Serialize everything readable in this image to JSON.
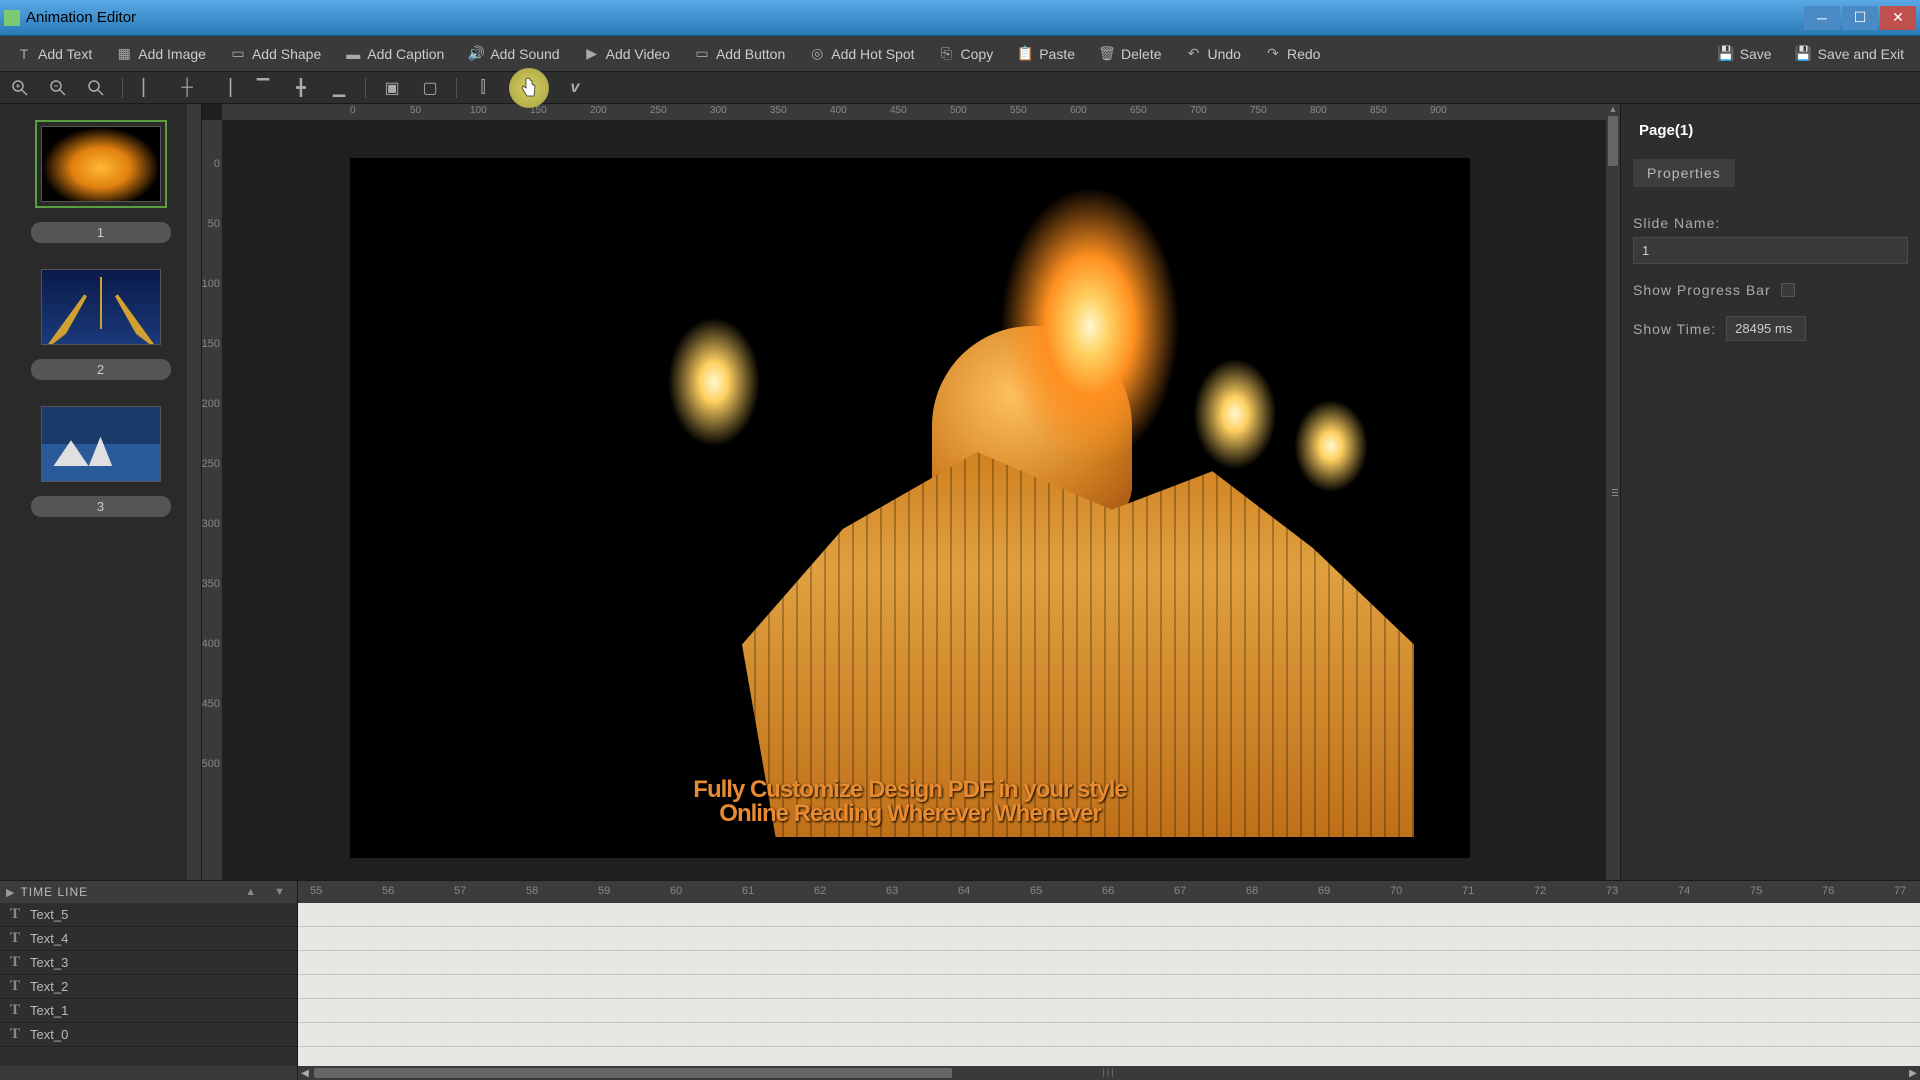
{
  "titlebar": {
    "title": "Animation Editor"
  },
  "toolbar": {
    "add_text": "Add Text",
    "add_image": "Add Image",
    "add_shape": "Add Shape",
    "add_caption": "Add Caption",
    "add_sound": "Add Sound",
    "add_video": "Add Video",
    "add_button": "Add Button",
    "add_hotspot": "Add Hot Spot",
    "copy": "Copy",
    "paste": "Paste",
    "delete": "Delete",
    "undo": "Undo",
    "redo": "Redo",
    "save": "Save",
    "save_exit": "Save and Exit"
  },
  "ruler_h": [
    "0",
    "50",
    "100",
    "150",
    "200",
    "250",
    "300",
    "350",
    "400",
    "450",
    "500",
    "550",
    "600",
    "650",
    "700",
    "750",
    "800",
    "850",
    "900"
  ],
  "ruler_v": [
    "0",
    "50",
    "100",
    "150",
    "200",
    "250",
    "300",
    "350",
    "400",
    "450",
    "500"
  ],
  "slides": [
    {
      "num": "1"
    },
    {
      "num": "2"
    },
    {
      "num": "3"
    }
  ],
  "canvas": {
    "overlay_line1": "Fully Customize Design PDF in your style",
    "overlay_line2": "Online Reading Wherever Whenever"
  },
  "properties": {
    "page_title": "Page(1)",
    "tab": "Properties",
    "slide_name_label": "Slide Name:",
    "slide_name_value": "1",
    "show_progress_label": "Show Progress Bar",
    "show_time_label": "Show Time:",
    "show_time_value": "28495 ms"
  },
  "timeline": {
    "title": "TIME LINE",
    "ticks": [
      "55",
      "56",
      "57",
      "58",
      "59",
      "60",
      "61",
      "62",
      "63",
      "64",
      "65",
      "66",
      "67",
      "68",
      "69",
      "70",
      "71",
      "72",
      "73",
      "74",
      "75",
      "76",
      "77"
    ],
    "tracks": [
      "Text_5",
      "Text_4",
      "Text_3",
      "Text_2",
      "Text_1",
      "Text_0"
    ]
  }
}
